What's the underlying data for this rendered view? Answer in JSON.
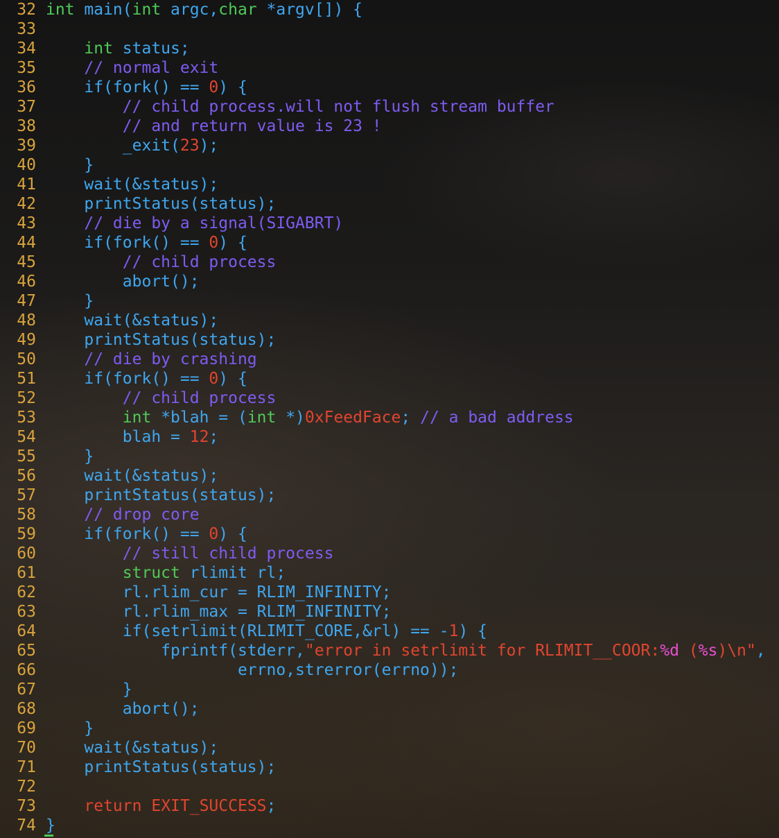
{
  "editor": {
    "lines": [
      {
        "num": "32",
        "tokens": [
          {
            "t": "int",
            "c": "k"
          },
          {
            "t": " main(",
            "c": "p"
          },
          {
            "t": "int",
            "c": "k"
          },
          {
            "t": " argc,",
            "c": "p"
          },
          {
            "t": "char",
            "c": "k"
          },
          {
            "t": " *argv[]) {",
            "c": "p"
          }
        ]
      },
      {
        "num": "33",
        "tokens": []
      },
      {
        "num": "34",
        "tokens": [
          {
            "t": "    ",
            "c": "p"
          },
          {
            "t": "int",
            "c": "k"
          },
          {
            "t": " status;",
            "c": "p"
          }
        ]
      },
      {
        "num": "35",
        "tokens": [
          {
            "t": "    ",
            "c": "p"
          },
          {
            "t": "// normal exit",
            "c": "c"
          }
        ]
      },
      {
        "num": "36",
        "tokens": [
          {
            "t": "    if(fork() == ",
            "c": "p"
          },
          {
            "t": "0",
            "c": "n"
          },
          {
            "t": ") {",
            "c": "p"
          }
        ]
      },
      {
        "num": "37",
        "tokens": [
          {
            "t": "        ",
            "c": "p"
          },
          {
            "t": "// child process.will not flush stream buffer",
            "c": "c"
          }
        ]
      },
      {
        "num": "38",
        "tokens": [
          {
            "t": "        ",
            "c": "p"
          },
          {
            "t": "// and return value is 23 !",
            "c": "c"
          }
        ]
      },
      {
        "num": "39",
        "tokens": [
          {
            "t": "        _exit(",
            "c": "p"
          },
          {
            "t": "23",
            "c": "n"
          },
          {
            "t": ");",
            "c": "p"
          }
        ]
      },
      {
        "num": "40",
        "tokens": [
          {
            "t": "    }",
            "c": "p"
          }
        ]
      },
      {
        "num": "41",
        "tokens": [
          {
            "t": "    wait(&status);",
            "c": "p"
          }
        ]
      },
      {
        "num": "42",
        "tokens": [
          {
            "t": "    printStatus(status);",
            "c": "p"
          }
        ]
      },
      {
        "num": "43",
        "tokens": [
          {
            "t": "    ",
            "c": "p"
          },
          {
            "t": "// die by a signal(SIGABRT)",
            "c": "c"
          }
        ]
      },
      {
        "num": "44",
        "tokens": [
          {
            "t": "    if(fork() == ",
            "c": "p"
          },
          {
            "t": "0",
            "c": "n"
          },
          {
            "t": ") {",
            "c": "p"
          }
        ]
      },
      {
        "num": "45",
        "tokens": [
          {
            "t": "        ",
            "c": "p"
          },
          {
            "t": "// child process",
            "c": "c"
          }
        ]
      },
      {
        "num": "46",
        "tokens": [
          {
            "t": "        abort();",
            "c": "p"
          }
        ]
      },
      {
        "num": "47",
        "tokens": [
          {
            "t": "    }",
            "c": "p"
          }
        ]
      },
      {
        "num": "48",
        "tokens": [
          {
            "t": "    wait(&status);",
            "c": "p"
          }
        ]
      },
      {
        "num": "49",
        "tokens": [
          {
            "t": "    printStatus(status);",
            "c": "p"
          }
        ]
      },
      {
        "num": "50",
        "tokens": [
          {
            "t": "    ",
            "c": "p"
          },
          {
            "t": "// die by crashing",
            "c": "c"
          }
        ]
      },
      {
        "num": "51",
        "tokens": [
          {
            "t": "    if(fork() == ",
            "c": "p"
          },
          {
            "t": "0",
            "c": "n"
          },
          {
            "t": ") {",
            "c": "p"
          }
        ]
      },
      {
        "num": "52",
        "tokens": [
          {
            "t": "        ",
            "c": "p"
          },
          {
            "t": "// child process",
            "c": "c"
          }
        ]
      },
      {
        "num": "53",
        "tokens": [
          {
            "t": "        ",
            "c": "p"
          },
          {
            "t": "int",
            "c": "k"
          },
          {
            "t": " *blah = (",
            "c": "p"
          },
          {
            "t": "int",
            "c": "k"
          },
          {
            "t": " *)",
            "c": "p"
          },
          {
            "t": "0xFeedFace",
            "c": "n"
          },
          {
            "t": "; ",
            "c": "p"
          },
          {
            "t": "// a bad address",
            "c": "c"
          }
        ]
      },
      {
        "num": "54",
        "tokens": [
          {
            "t": "        blah = ",
            "c": "p"
          },
          {
            "t": "12",
            "c": "n"
          },
          {
            "t": ";",
            "c": "p"
          }
        ]
      },
      {
        "num": "55",
        "tokens": [
          {
            "t": "    }",
            "c": "p"
          }
        ]
      },
      {
        "num": "56",
        "tokens": [
          {
            "t": "    wait(&status);",
            "c": "p"
          }
        ]
      },
      {
        "num": "57",
        "tokens": [
          {
            "t": "    printStatus(status);",
            "c": "p"
          }
        ]
      },
      {
        "num": "58",
        "tokens": [
          {
            "t": "    ",
            "c": "p"
          },
          {
            "t": "// drop core",
            "c": "c"
          }
        ]
      },
      {
        "num": "59",
        "tokens": [
          {
            "t": "    if(fork() == ",
            "c": "p"
          },
          {
            "t": "0",
            "c": "n"
          },
          {
            "t": ") {",
            "c": "p"
          }
        ]
      },
      {
        "num": "60",
        "tokens": [
          {
            "t": "        ",
            "c": "p"
          },
          {
            "t": "// still child process",
            "c": "c"
          }
        ]
      },
      {
        "num": "61",
        "tokens": [
          {
            "t": "        ",
            "c": "p"
          },
          {
            "t": "struct",
            "c": "k"
          },
          {
            "t": " rlimit rl;",
            "c": "p"
          }
        ]
      },
      {
        "num": "62",
        "tokens": [
          {
            "t": "        rl.rlim_cur = RLIM_INFINITY;",
            "c": "p"
          }
        ]
      },
      {
        "num": "63",
        "tokens": [
          {
            "t": "        rl.rlim_max = RLIM_INFINITY;",
            "c": "p"
          }
        ]
      },
      {
        "num": "64",
        "tokens": [
          {
            "t": "        if(setrlimit(RLIMIT_CORE,&rl) == -",
            "c": "p"
          },
          {
            "t": "1",
            "c": "n"
          },
          {
            "t": ") {",
            "c": "p"
          }
        ]
      },
      {
        "num": "65",
        "tokens": [
          {
            "t": "            fprintf(stderr,",
            "c": "p"
          },
          {
            "t": "\"error in setrlimit for RLIMIT__COOR:",
            "c": "s"
          },
          {
            "t": "%d",
            "c": "f"
          },
          {
            "t": " (",
            "c": "s"
          },
          {
            "t": "%s",
            "c": "f"
          },
          {
            "t": ")\\n\"",
            "c": "s"
          },
          {
            "t": ",",
            "c": "p"
          }
        ]
      },
      {
        "num": "66",
        "tokens": [
          {
            "t": "                    errno,strerror(errno));",
            "c": "p"
          }
        ]
      },
      {
        "num": "67",
        "tokens": [
          {
            "t": "        }",
            "c": "p"
          }
        ]
      },
      {
        "num": "68",
        "tokens": [
          {
            "t": "        abort();",
            "c": "p"
          }
        ]
      },
      {
        "num": "69",
        "tokens": [
          {
            "t": "    }",
            "c": "p"
          }
        ]
      },
      {
        "num": "70",
        "tokens": [
          {
            "t": "    wait(&status);",
            "c": "p"
          }
        ]
      },
      {
        "num": "71",
        "tokens": [
          {
            "t": "    printStatus(status);",
            "c": "p"
          }
        ]
      },
      {
        "num": "72",
        "tokens": []
      },
      {
        "num": "73",
        "tokens": [
          {
            "t": "    ",
            "c": "p"
          },
          {
            "t": "return",
            "c": "n"
          },
          {
            "t": " ",
            "c": "p"
          },
          {
            "t": "EXIT_SUCCESS",
            "c": "n"
          },
          {
            "t": ";",
            "c": "p"
          }
        ]
      },
      {
        "num": "74",
        "tokens": [
          {
            "t": "}",
            "c": "p"
          }
        ]
      }
    ]
  },
  "colors": {
    "line_number": "#d9a43d",
    "keyword": "#4fca56",
    "comment": "#7e5cf2",
    "number": "#e1452f",
    "plain": "#3fa7f0",
    "format": "#e74fd2"
  }
}
